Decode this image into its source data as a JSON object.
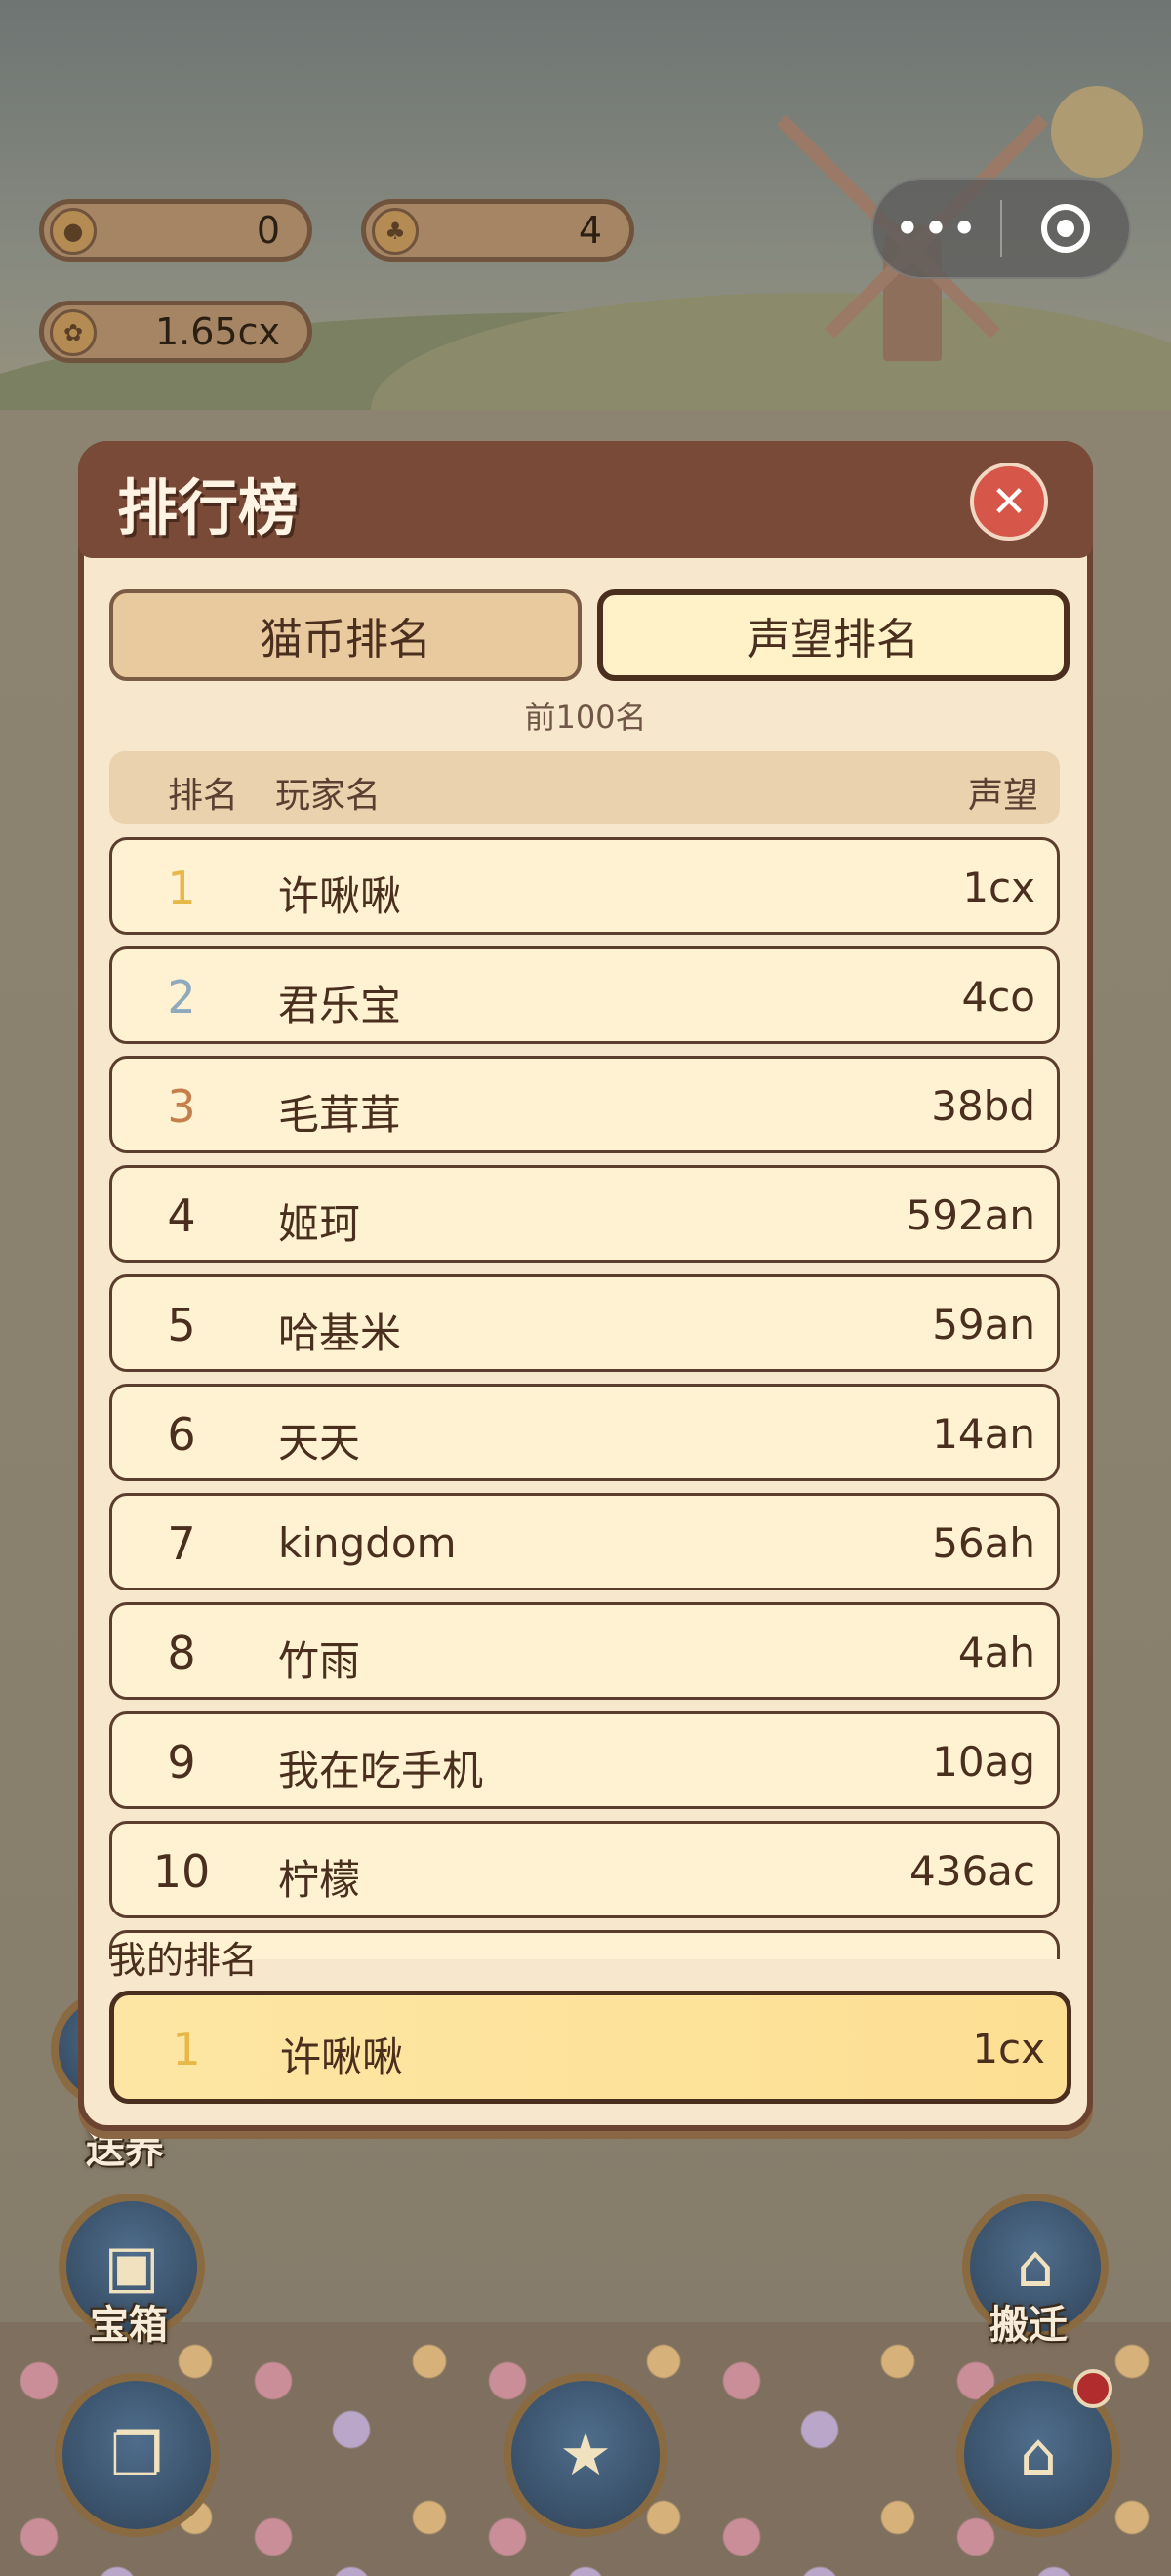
{
  "status": {
    "coins": "0",
    "grass": "4",
    "multiplier": "1.65cx"
  },
  "capsule": {
    "more_icon": "•••"
  },
  "leaderboard": {
    "title": "排行榜",
    "close_icon": "✕",
    "tabs": [
      {
        "label": "猫币排名",
        "active": false
      },
      {
        "label": "声望排名",
        "active": true
      }
    ],
    "caption": "前100名",
    "columns": {
      "rank": "排名",
      "player": "玩家名",
      "score": "声望"
    },
    "rows": [
      {
        "rank": "1",
        "name": "许啾啾",
        "score": "1cx",
        "color": "#e8b74a"
      },
      {
        "rank": "2",
        "name": "君乐宝",
        "score": "4co",
        "color": "#8fa9bd"
      },
      {
        "rank": "3",
        "name": "毛茸茸",
        "score": "38bd",
        "color": "#c57f4c"
      },
      {
        "rank": "4",
        "name": "姬珂",
        "score": "592an",
        "color": "#4a2e1e"
      },
      {
        "rank": "5",
        "name": "哈基米",
        "score": "59an",
        "color": "#4a2e1e"
      },
      {
        "rank": "6",
        "name": "天天",
        "score": "14an",
        "color": "#4a2e1e"
      },
      {
        "rank": "7",
        "name": "kingdom",
        "score": "56ah",
        "color": "#4a2e1e"
      },
      {
        "rank": "8",
        "name": "竹雨",
        "score": "4ah",
        "color": "#4a2e1e"
      },
      {
        "rank": "9",
        "name": "我在吃手机",
        "score": "10ag",
        "color": "#4a2e1e"
      },
      {
        "rank": "10",
        "name": "柠檬",
        "score": "436ac",
        "color": "#4a2e1e"
      }
    ],
    "my_rank_label": "我的排名",
    "my_rank": {
      "rank": "1",
      "name": "许啾啾",
      "score": "1cx",
      "color": "#e8b74a"
    }
  },
  "bottom_buttons": {
    "chest_label": "宝箱",
    "move_label": "搬迁",
    "partial_label": "送养"
  }
}
